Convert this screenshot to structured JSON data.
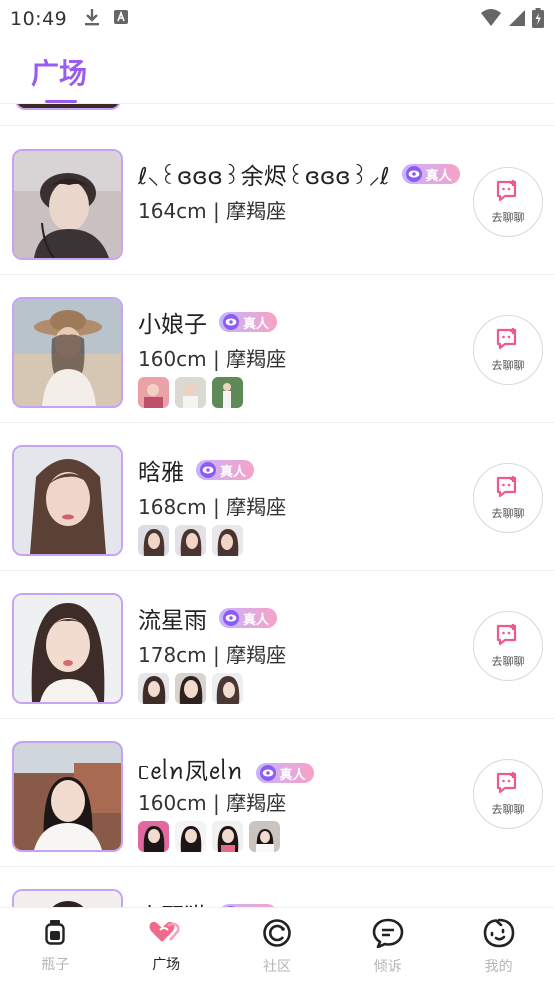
{
  "status_bar": {
    "time": "10:49"
  },
  "header": {
    "tab_label": "广场"
  },
  "badge_label": "真人",
  "chat_button_label": "去聊聊",
  "accent_color": "#9a5cf0",
  "users": [
    {
      "name": "ℓ⸜꒰ɞɞɞ꒱余烬꒰ɞɞɞ꒱⸝ℓ",
      "info": "164cm | 摩羯座",
      "thumb_count": 0
    },
    {
      "name": "小娘子",
      "info": "160cm | 摩羯座",
      "thumb_count": 3
    },
    {
      "name": "晗雅",
      "info": "168cm | 摩羯座",
      "thumb_count": 3
    },
    {
      "name": "流星雨",
      "info": "178cm | 摩羯座",
      "thumb_count": 3
    },
    {
      "name": "ᥴꫀᥣꪀ凤ꫀᥣꪀ",
      "info": "160cm | 摩羯座",
      "thumb_count": 4
    },
    {
      "name": "小野猫",
      "info": "",
      "thumb_count": 0
    }
  ],
  "bottom_nav": [
    {
      "label": "瓶子",
      "icon": "bottle-icon",
      "active": false
    },
    {
      "label": "广场",
      "icon": "heart-icon",
      "active": true
    },
    {
      "label": "社区",
      "icon": "community-icon",
      "active": false
    },
    {
      "label": "倾诉",
      "icon": "chat-bubble-icon",
      "active": false
    },
    {
      "label": "我的",
      "icon": "face-icon",
      "active": false
    }
  ]
}
